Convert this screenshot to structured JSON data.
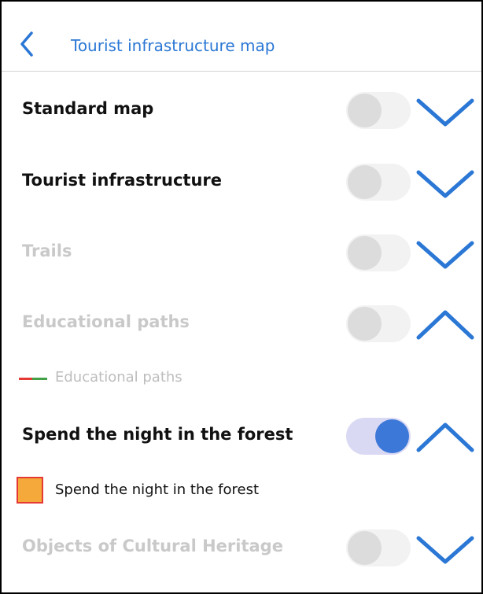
{
  "header": {
    "title": "Tourist infrastructure map",
    "back_icon": "chevron-left-icon"
  },
  "colors": {
    "accent": "#2b77d5",
    "toggle_on_track": "#dad9f4",
    "toggle_on_knob": "#3c78d8",
    "disabled_text": "#c9c9c9",
    "legend_line_red": "#e53935",
    "legend_line_green": "#43a047",
    "legend_square_fill": "#f5a93b",
    "legend_square_border": "#e53935"
  },
  "layers": [
    {
      "label": "Standard map",
      "enabled": true,
      "toggle_on": false,
      "expanded": false
    },
    {
      "label": "Tourist infrastructure",
      "enabled": true,
      "toggle_on": false,
      "expanded": false
    },
    {
      "label": "Trails",
      "enabled": false,
      "toggle_on": false,
      "expanded": false
    },
    {
      "label": "Educational paths",
      "enabled": false,
      "toggle_on": false,
      "expanded": true
    },
    {
      "label": "Spend the night in the forest",
      "enabled": true,
      "toggle_on": true,
      "expanded": true
    },
    {
      "label": "Objects of Cultural Heritage",
      "enabled": false,
      "toggle_on": false,
      "expanded": false
    }
  ],
  "legends": {
    "educational_paths": {
      "label": "Educational paths",
      "symbol": "red-green-line"
    },
    "spend_the_night": {
      "label": "Spend the night in the forest",
      "symbol": "orange-square"
    }
  }
}
